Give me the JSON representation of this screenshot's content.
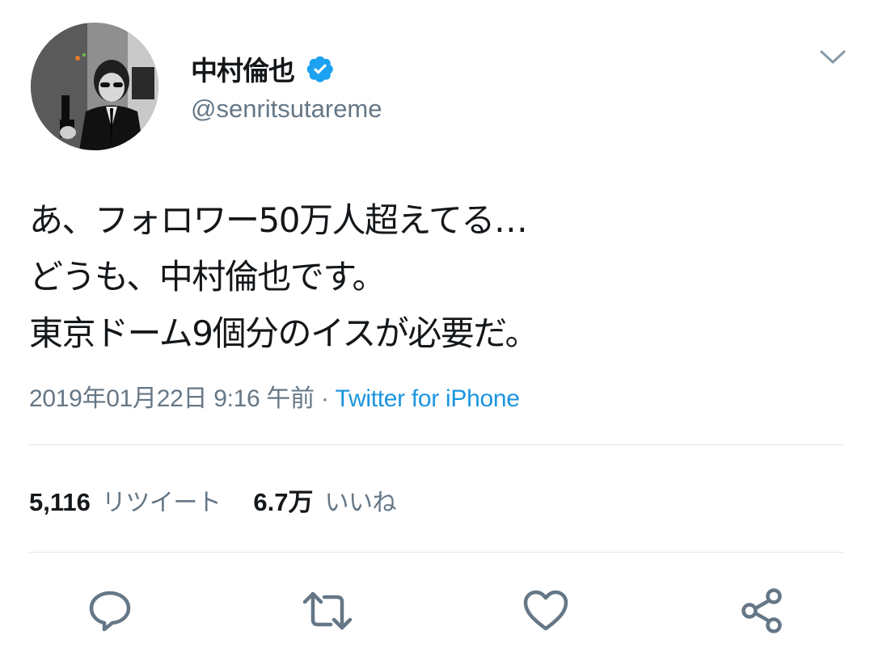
{
  "header": {
    "display_name": "中村倫也",
    "handle": "@senritsutareme",
    "verified": true,
    "avatar": "profile-photo",
    "menu_icon": "chevron-down-icon"
  },
  "tweet": {
    "lines": [
      "あ、フォロワー50万人超えてる…",
      "どうも、中村倫也です。",
      "東京ドーム9個分のイスが必要だ。"
    ],
    "timestamp": "2019年01月22日 9:16 午前",
    "separator": " · ",
    "source": "Twitter for iPhone"
  },
  "stats": {
    "retweets_count": "5,116",
    "retweets_label": "リツイート",
    "likes_count": "6.7万",
    "likes_label": "いいね"
  },
  "actions": [
    {
      "name": "reply",
      "icon": "reply-icon"
    },
    {
      "name": "retweet",
      "icon": "retweet-icon"
    },
    {
      "name": "like",
      "icon": "heart-icon"
    },
    {
      "name": "share",
      "icon": "share-icon"
    }
  ],
  "colors": {
    "text_primary": "#14171a",
    "text_secondary": "#657786",
    "link": "#1b95e0",
    "verified": "#1da1f2",
    "divider": "#e1e8ed"
  }
}
